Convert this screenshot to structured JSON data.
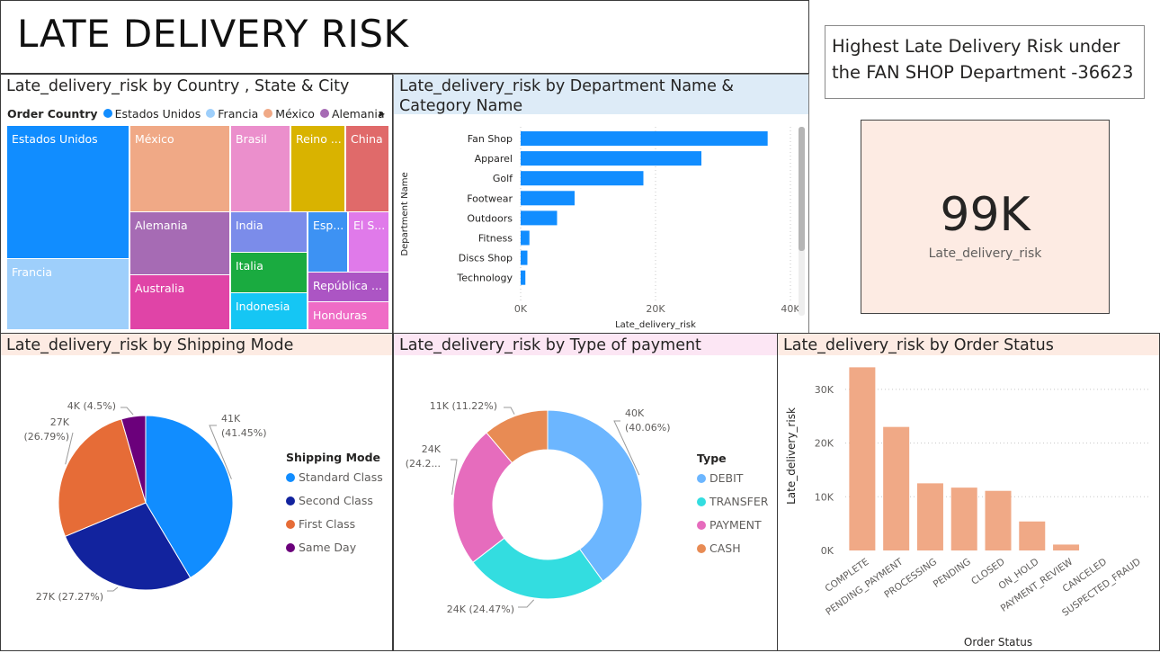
{
  "page_title": "LATE DELIVERY RISK",
  "insight_text": "Highest Late Delivery Risk under the FAN SHOP Department -36623",
  "card": {
    "value": "99K",
    "label": "Late_delivery_risk"
  },
  "treemap": {
    "title": "Late_delivery_risk by Country , State & City",
    "legend_title": "Order Country",
    "legend_items": [
      {
        "name": "Estados Unidos",
        "color": "#118DFF"
      },
      {
        "name": "Francia",
        "color": "#9ECFFB"
      },
      {
        "name": "México",
        "color": "#F0A986"
      },
      {
        "name": "Alemania",
        "color": "#A66BB4"
      }
    ],
    "more_arrow": "▸",
    "tiles": [
      {
        "label": "Estados Unidos",
        "color": "#118DFF"
      },
      {
        "label": "Francia",
        "color": "#9ECFFB"
      },
      {
        "label": "México",
        "color": "#F0A986"
      },
      {
        "label": "Alemania",
        "color": "#A66BB4"
      },
      {
        "label": "Australia",
        "color": "#E044A7"
      },
      {
        "label": "Brasil",
        "color": "#EB8FCC"
      },
      {
        "label": "Reino ...",
        "color": "#D9B300"
      },
      {
        "label": "China",
        "color": "#E06A6A"
      },
      {
        "label": "India",
        "color": "#7B8CEA"
      },
      {
        "label": "Esp...",
        "color": "#3D92F3"
      },
      {
        "label": "El S...",
        "color": "#E07AEA"
      },
      {
        "label": "Italia",
        "color": "#1AAB40"
      },
      {
        "label": "República ...",
        "color": "#AC55C4"
      },
      {
        "label": "Indonesia",
        "color": "#15C6F4"
      },
      {
        "label": "Honduras",
        "color": "#EF6CC6"
      }
    ]
  },
  "chart_data": [
    {
      "type": "bar",
      "orientation": "horizontal",
      "title": "Late_delivery_risk by Department Name & Category Name",
      "xlabel": "Late_delivery_risk",
      "ylabel": "Department Name",
      "categories": [
        "Fan Shop",
        "Apparel",
        "Golf",
        "Footwear",
        "Outdoors",
        "Fitness",
        "Discs Shop",
        "Technology"
      ],
      "values": [
        36623,
        26800,
        18200,
        8000,
        5400,
        1300,
        1000,
        700
      ],
      "xlim": [
        0,
        40000
      ],
      "xticks": [
        "0K",
        "20K",
        "40K"
      ],
      "color": "#118DFF"
    },
    {
      "type": "pie",
      "title": "Late_delivery_risk by Shipping Mode",
      "legend_title": "Shipping Mode",
      "categories": [
        "Standard Class",
        "Second Class",
        "First Class",
        "Same Day"
      ],
      "values": [
        41.45,
        27.27,
        26.79,
        4.5
      ],
      "labels": [
        "41K (41.45%)",
        "27K (27.27%)",
        "27K (26.79%)",
        "4K (4.5%)"
      ],
      "colors": [
        "#118DFF",
        "#12239E",
        "#E66C37",
        "#6B007B"
      ]
    },
    {
      "type": "pie",
      "donut": true,
      "title": "Late_delivery_risk by Type of payment",
      "legend_title": "Type",
      "categories": [
        "DEBIT",
        "TRANSFER",
        "PAYMENT",
        "CASH"
      ],
      "values": [
        40.06,
        24.47,
        24.25,
        11.22
      ],
      "labels": [
        "40K (40.06%)",
        "24K (24.47%)",
        "24K (24.2...",
        "11K (11.22%)"
      ],
      "colors": [
        "#6CB6FF",
        "#33DDE0",
        "#E66CBD",
        "#E88B54"
      ]
    },
    {
      "type": "bar",
      "title": "Late_delivery_risk by Order Status",
      "xlabel": "Order Status",
      "ylabel": "Late_delivery_risk",
      "categories": [
        "COMPLETE",
        "PENDING_PAYMENT",
        "PROCESSING",
        "PENDING",
        "CLOSED",
        "ON_HOLD",
        "PAYMENT_REVIEW",
        "CANCELED",
        "SUSPECTED_FRAUD"
      ],
      "values": [
        34100,
        23000,
        12500,
        11700,
        11100,
        5400,
        1100,
        0,
        0
      ],
      "ylim": [
        0,
        35000
      ],
      "yticks": [
        "0K",
        "10K",
        "20K",
        "30K"
      ],
      "color": "#F0A986"
    }
  ]
}
